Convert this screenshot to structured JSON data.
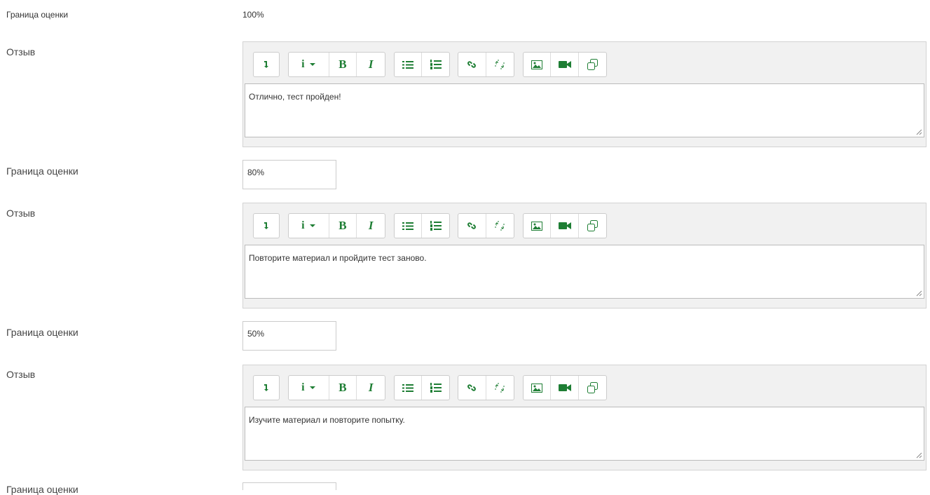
{
  "grade_rows": [
    {
      "label": "Граница оценки",
      "value": "100%"
    },
    {
      "label": "Граница оценки",
      "value": "80%"
    },
    {
      "label": "Граница оценки",
      "value": "50%"
    },
    {
      "label": "Граница оценки",
      "value": ""
    }
  ],
  "feedback_rows": [
    {
      "label": "Отзыв",
      "text": "Отлично, тест пройден!"
    },
    {
      "label": "Отзыв",
      "text": "Повторите материал и пройдите тест заново."
    },
    {
      "label": "Отзыв",
      "text": "Изучите материал и повторите попытку."
    }
  ],
  "toolbar": {
    "icons": [
      "collapse-icon",
      "info-dropdown-icon",
      "bold-icon",
      "italic-icon",
      "unordered-list-icon",
      "ordered-list-icon",
      "link-icon",
      "unlink-icon",
      "image-icon",
      "video-icon",
      "copy-icon"
    ],
    "bold_glyph": "B",
    "italic_glyph": "I",
    "info_glyph": "i"
  },
  "colors": {
    "icon": "#1e7e34",
    "toolbar_bg": "#f1f1f1",
    "border": "#cccccc"
  }
}
